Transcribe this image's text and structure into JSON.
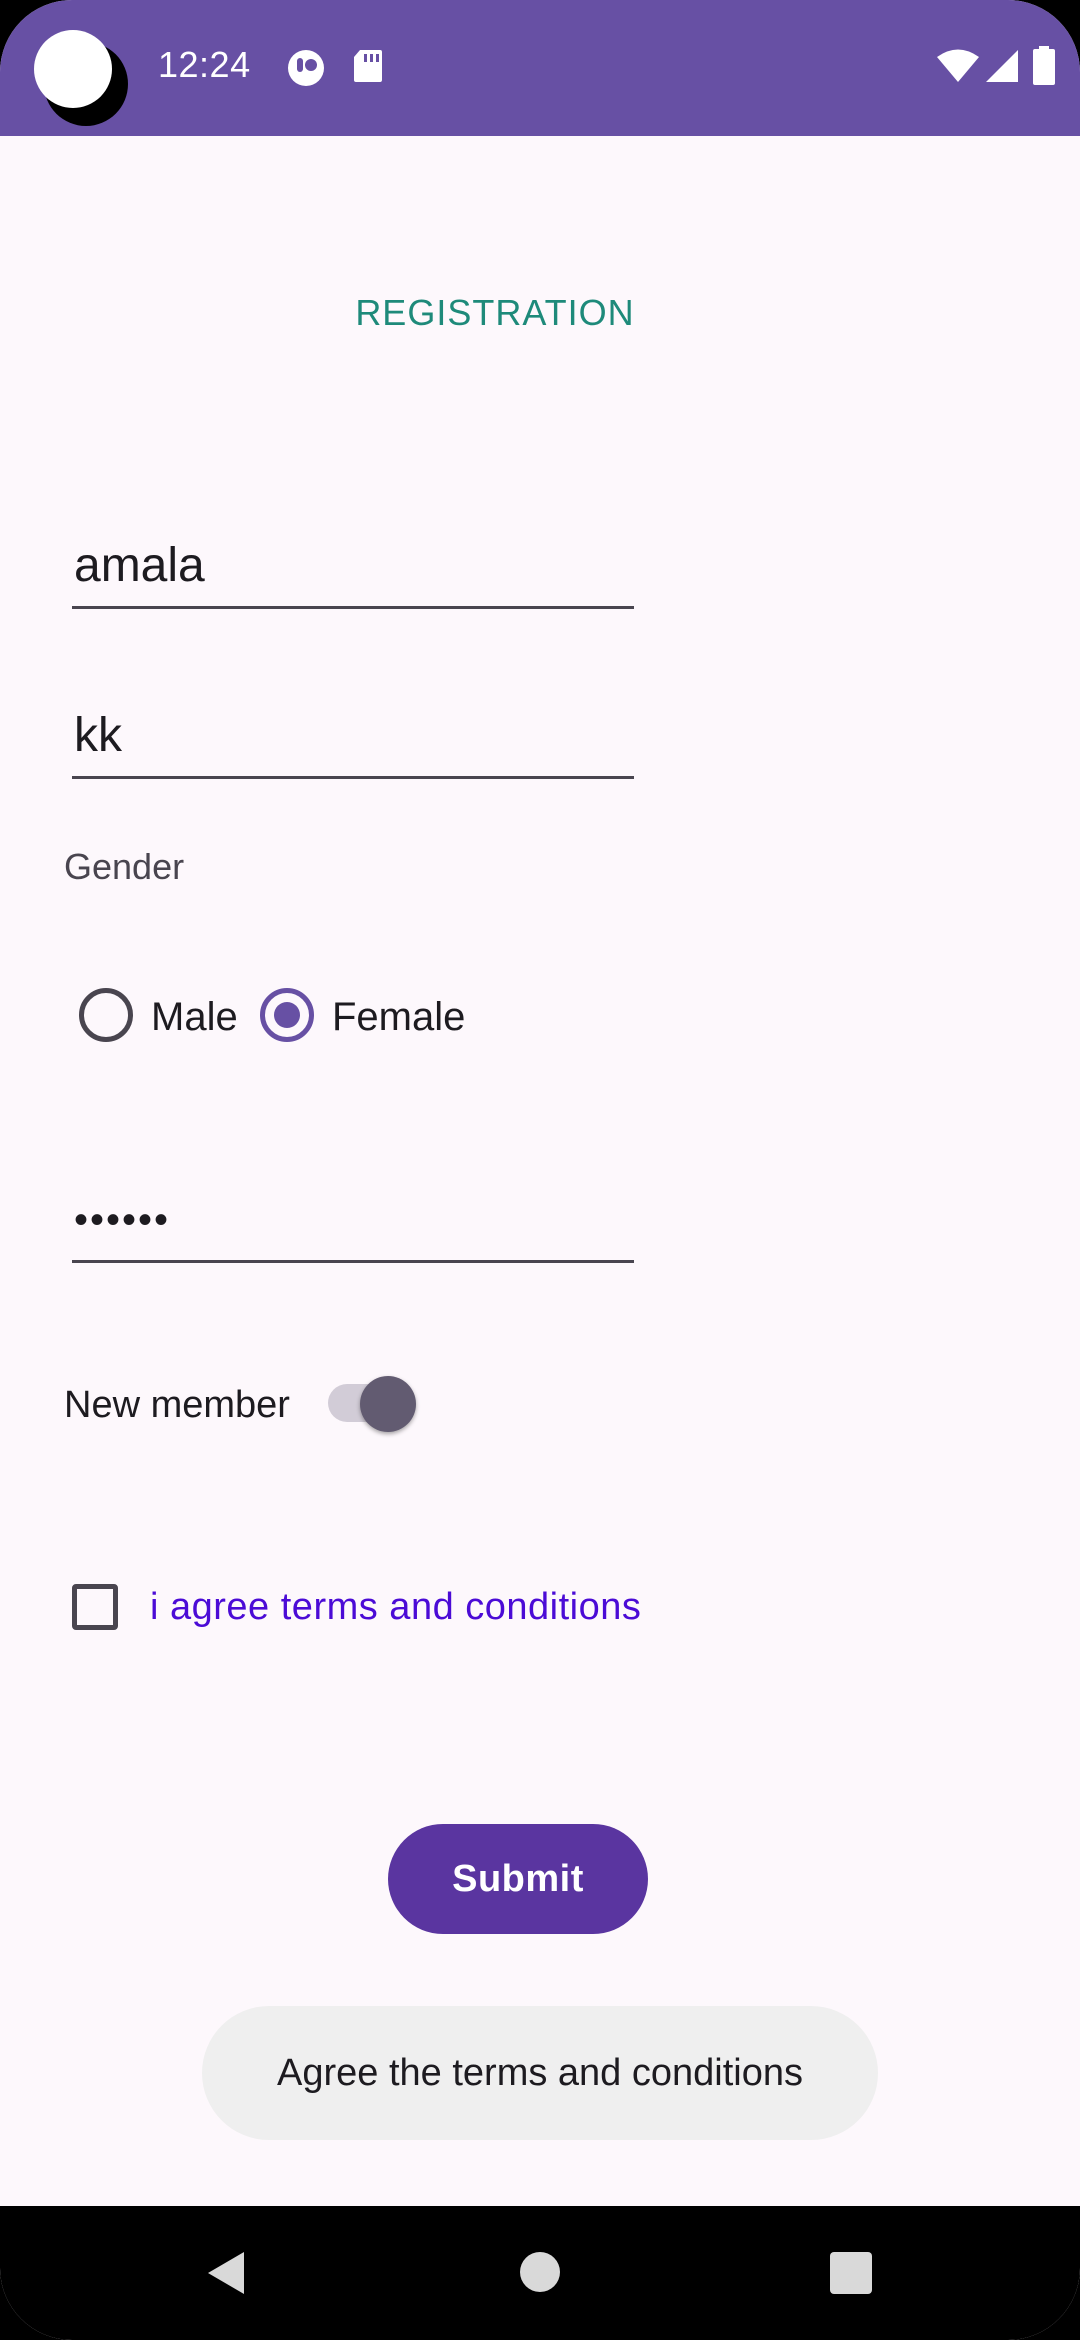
{
  "status_bar": {
    "time": "12:24",
    "background_color": "#6750A4",
    "left_icons": [
      "notification-app-icon",
      "sd-card-icon"
    ],
    "right_icons": [
      "wifi-icon",
      "cellular-signal-icon",
      "battery-icon"
    ]
  },
  "form": {
    "title": "REGISTRATION",
    "first_name_value": "amala",
    "last_name_value": "kk",
    "gender_label": "Gender",
    "gender_options": [
      {
        "label": "Male",
        "selected": false
      },
      {
        "label": "Female",
        "selected": true
      }
    ],
    "password_value": "••••••",
    "new_member_label": "New member",
    "new_member_on": true,
    "terms_label": "i agree terms and conditions",
    "terms_checked": false,
    "submit_label": "Submit"
  },
  "toast": {
    "message": "Agree the terms and conditions"
  },
  "nav_bar": {
    "buttons": [
      "back-icon",
      "home-icon",
      "recents-icon"
    ]
  },
  "colors": {
    "primary": "#6750A4",
    "title_teal": "#1E8A7A",
    "link_purple": "#4B0BD6",
    "button": "#5A35A0",
    "background": "#FDF8FC"
  }
}
